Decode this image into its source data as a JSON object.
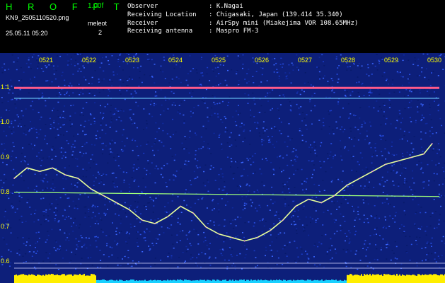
{
  "header": {
    "logo": "H R O F F T",
    "version": "1.00f",
    "filename": "KN9_2505110520.png",
    "datetime": "25.05.11 05:20",
    "meleot_label": "meleot",
    "meleot_value": "2",
    "info_rows": [
      {
        "key": "Observer",
        "value": ": K.Nagai"
      },
      {
        "key": "Receiving Location",
        "value": ": Chigasaki, Japan (139.414 35.340)"
      },
      {
        "key": "Receiver",
        "value": ": AirSpy mini (Miakejima VOR 108.65MHz)"
      },
      {
        "key": "Receiving antenna",
        "value": ": Maspro FM-3"
      }
    ]
  },
  "chart_data": {
    "type": "line",
    "y_unit": "kHz",
    "x_ticks": [
      "0521",
      "0522",
      "0523",
      "0524",
      "0525",
      "0526",
      "0527",
      "0528",
      "0529",
      "0530"
    ],
    "y_ticks": [
      "1.1",
      "1.0",
      "0.9",
      "0.8",
      "0.7",
      "0.6"
    ],
    "ylim": [
      0.58,
      1.2
    ],
    "series": [
      {
        "values_x_minutes": [
          0.0,
          0.3,
          0.6,
          0.9,
          1.2,
          1.5,
          1.8,
          2.1,
          2.4,
          2.7,
          3.0,
          3.3,
          3.6,
          3.9,
          4.2,
          4.5,
          4.8,
          5.1,
          5.4,
          5.7,
          6.0,
          6.3,
          6.6,
          6.9,
          7.2,
          7.5,
          7.8,
          8.1,
          8.4,
          8.7,
          9.0,
          9.3,
          9.6,
          9.8
        ],
        "values_khz": [
          0.84,
          0.87,
          0.86,
          0.87,
          0.85,
          0.84,
          0.81,
          0.79,
          0.77,
          0.75,
          0.72,
          0.71,
          0.73,
          0.76,
          0.74,
          0.7,
          0.68,
          0.67,
          0.66,
          0.67,
          0.69,
          0.72,
          0.76,
          0.78,
          0.77,
          0.79,
          0.82,
          0.84,
          0.86,
          0.88,
          0.89,
          0.9,
          0.91,
          0.94
        ]
      }
    ],
    "reference_lines_khz": [
      1.1,
      1.07,
      0.8
    ]
  }
}
